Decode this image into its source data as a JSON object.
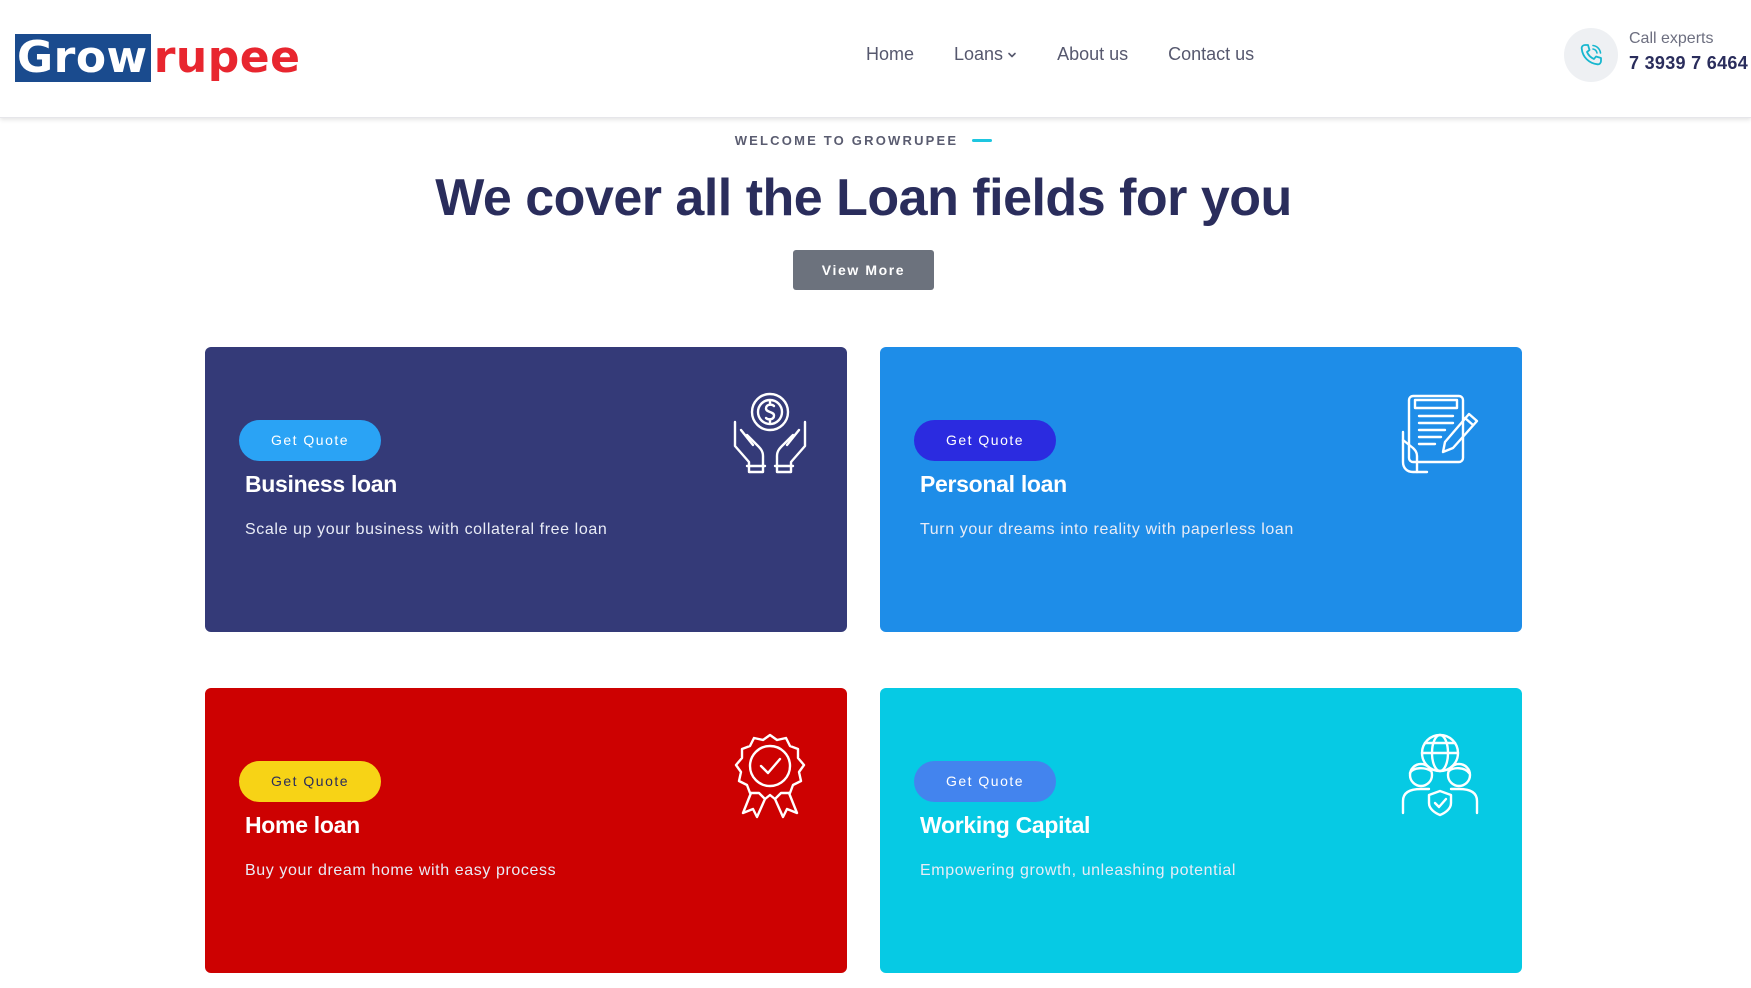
{
  "brand": {
    "part1": "Grow",
    "part2": "rupee",
    "colors": {
      "blue": "#1a4b8e",
      "red": "#e8262f"
    }
  },
  "nav": {
    "items": [
      {
        "label": "Home",
        "has_dropdown": false
      },
      {
        "label": "Loans",
        "has_dropdown": true
      },
      {
        "label": "About us",
        "has_dropdown": false
      },
      {
        "label": "Contact us",
        "has_dropdown": false
      }
    ]
  },
  "contact": {
    "label": "Call experts",
    "number": "7 3939 7 6464",
    "icon": "phone-icon"
  },
  "hero": {
    "subtitle": "WELCOME TO GROWRUPEE",
    "headline": "We cover all the Loan fields for you",
    "button": "View More"
  },
  "cards": [
    {
      "title": "Business loan",
      "description": "Scale up your business with collateral free loan",
      "button": "Get Quote",
      "icon": "hands-coin-icon",
      "bg": "#343a78",
      "button_bg": "#2aa3f5",
      "button_color": "#ffffff"
    },
    {
      "title": "Personal loan",
      "description": "Turn your dreams into reality with paperless loan",
      "button": "Get Quote",
      "icon": "document-pen-icon",
      "bg": "#1e8de8",
      "button_bg": "#2b2be0",
      "button_color": "#ffffff"
    },
    {
      "title": "Home loan",
      "description": "Buy your dream home with easy process",
      "button": "Get Quote",
      "icon": "badge-check-icon",
      "bg": "#cd0101",
      "button_bg": "#f7d316",
      "button_color": "#2a2d5c"
    },
    {
      "title": "Working Capital",
      "description": "Empowering growth, unleashing potential",
      "button": "Get Quote",
      "icon": "team-globe-icon",
      "bg": "#06cae4",
      "button_bg": "#4384ee",
      "button_color": "#ffffff"
    }
  ]
}
